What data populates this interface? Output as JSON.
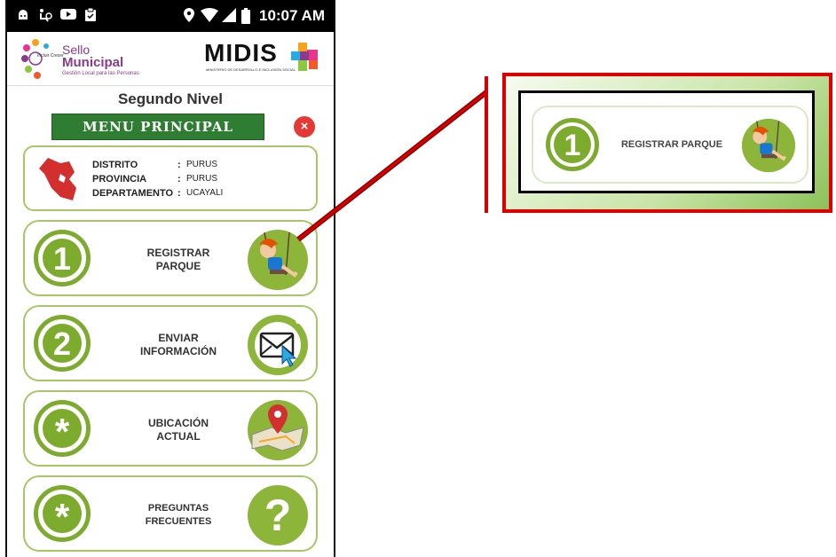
{
  "status_bar": {
    "time": "10:07 AM",
    "icons": [
      "android-icon",
      "accessibility-icon",
      "youtube-icon",
      "clipboard-icon",
      "location-icon",
      "wifi-icon",
      "signal-icon",
      "battery-icon"
    ]
  },
  "header": {
    "logo_left_line1": "Sello",
    "logo_left_line2": "Municipal",
    "logo_left_tagline": "Gestión Local para las Personas",
    "logo_left_small": "Incluir Crecer",
    "logo_right": "MIDIS",
    "logo_right_sub": "MINISTERIO DE DESARROLLO E INCLUSIÓN SOCIAL"
  },
  "level_title": "Segundo Nivel",
  "menu_banner": "MENU PRINCIPAL",
  "close_button": "×",
  "info": {
    "rows": [
      {
        "key": "DISTRITO",
        "sep": ":",
        "value": "PURUS"
      },
      {
        "key": "PROVINCIA",
        "sep": ":",
        "value": "PURUS"
      },
      {
        "key": "DEPARTAMENTO",
        "sep": ":",
        "value": "UCAYALI"
      }
    ]
  },
  "menu": [
    {
      "badge": "1",
      "label_line1": "REGISTRAR",
      "label_line2": "PARQUE",
      "icon": "child-swing-icon"
    },
    {
      "badge": "2",
      "label_line1": "ENVIAR",
      "label_line2": "INFORMACIÓN",
      "icon": "envelope-cursor-icon"
    },
    {
      "badge": "*",
      "label_line1": "UBICACIÓN",
      "label_line2": "ACTUAL",
      "icon": "map-pin-icon"
    },
    {
      "badge": "*",
      "label_line1": "PREGUNTAS",
      "label_line2": "FRECUENTES",
      "icon": "question-icon"
    }
  ],
  "zoom": {
    "badge": "1",
    "label": "REGISTRAR PARQUE",
    "icon": "child-swing-icon"
  },
  "colors": {
    "accent_green": "#7cab2d",
    "banner_green": "#2e7d32",
    "card_border": "#a5c864",
    "highlight_red": "#e00000",
    "close_red": "#e53935"
  }
}
